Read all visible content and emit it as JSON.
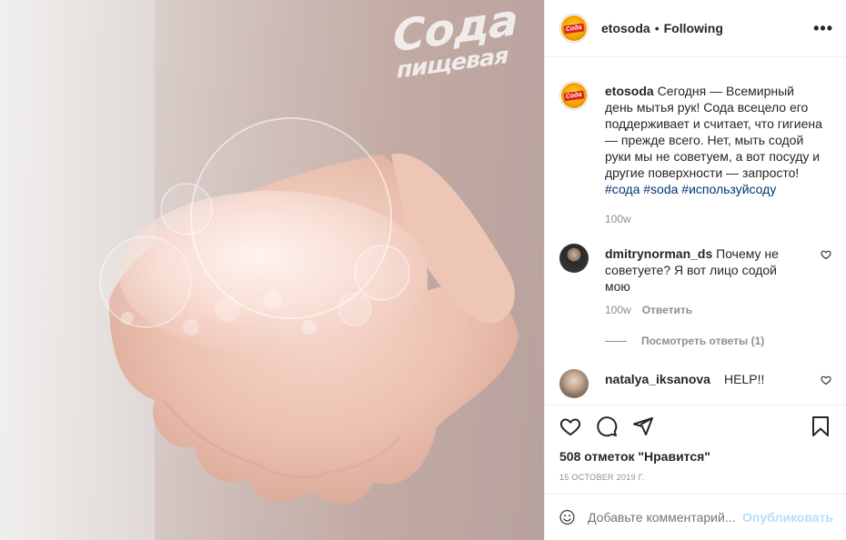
{
  "photo": {
    "brand_line1": "Сода",
    "brand_line2": "пищевая"
  },
  "header": {
    "username": "etosoda",
    "separator": "•",
    "follow_status": "Following",
    "more_label": "•••",
    "logo_text": "Сода"
  },
  "caption": {
    "username": "etosoda",
    "text": "Сегодня — Всемирный день мытья рук! Сода всецело его поддерживает и считает, что гигиена — прежде всего. Нет, мыть содой руки мы не советуем, а вот посуду и другие поверхности — запросто!",
    "hashtags": "#сода #soda #используйсоду",
    "time": "100w"
  },
  "comments": [
    {
      "username": "dmitrynorman_ds",
      "text": "Почему не советуете? Я вот лицо содой мою",
      "time": "100w",
      "reply_label": "Ответить",
      "view_replies": "Посмотреть ответы (1)"
    },
    {
      "username": "natalya_iksanova",
      "text": "HELP!!"
    }
  ],
  "actions": {
    "likes": "508 отметок \"Нравится\"",
    "date": "15 OCTOBER 2019 Г."
  },
  "add_comment": {
    "placeholder": "Добавьте комментарий...",
    "post_label": "Опубликовать"
  }
}
